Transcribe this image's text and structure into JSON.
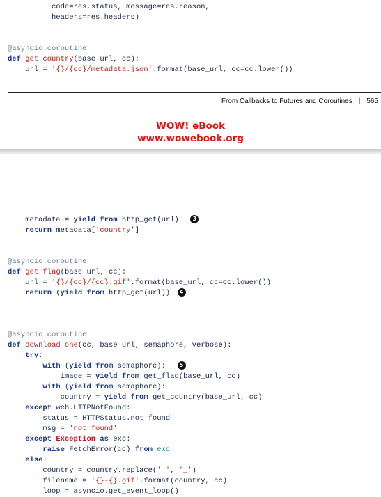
{
  "footer": {
    "title": "From Callbacks to Futures and Coroutines",
    "separator": "|",
    "page_number": "565"
  },
  "watermark": {
    "line1": "WOW! eBook",
    "line2": "www.wowebook.org"
  },
  "callouts": {
    "c3": "3",
    "c4": "4",
    "c5": "5"
  },
  "strings": {
    "s1": "'{}/{cc}/metadata.json'",
    "s2": "'country'",
    "s3": "'{}/{cc}/{cc}.gif'",
    "s4": "'not found'",
    "s5": "' '",
    "s6": "'_'",
    "s7": "'{}-{}.gif'"
  }
}
